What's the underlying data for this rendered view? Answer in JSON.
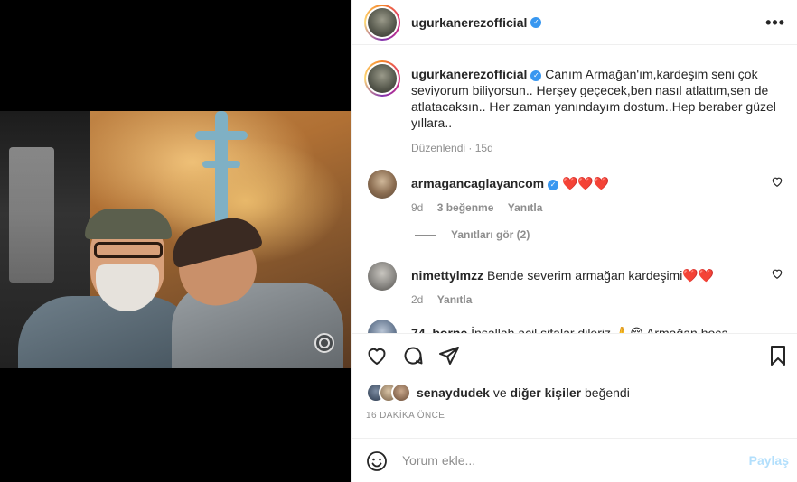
{
  "post": {
    "username": "ugurkanerezofficial",
    "verified_icon": "verified-badge-icon",
    "caption": "Canım Armağan'ım,kardeşim seni çok seviyorum biliyorsun.. Herşey geçecek,ben nasıl atlattım,sen de atlatacaksın.. Her zaman yanındayım dostum..Hep beraber güzel yıllara..",
    "edited_label": "Düzenlendi",
    "caption_age": "15d"
  },
  "comments": [
    {
      "username": "armagancaglayancom",
      "verified": true,
      "text": "❤️❤️❤️",
      "age": "9d",
      "likes": "3 beğenme",
      "reply_label": "Yanıtla",
      "view_replies": "Yanıtları gör (2)"
    },
    {
      "username": "nimettylmzz",
      "verified": false,
      "text": "Bende severim armağan kardeşimi❤️❤️",
      "age": "2d",
      "reply_label": "Yanıtla"
    },
    {
      "username": "74_borne",
      "text": "İnşallah acil şifalar dileriz 🙏😔 Armağan hoca"
    }
  ],
  "liked_by": {
    "user": "senaydudek",
    "connector": "ve",
    "others": "diğer kişiler",
    "suffix": "beğendi"
  },
  "timestamp": "16 DAKİKA ÖNCE",
  "add_comment": {
    "placeholder": "Yorum ekle...",
    "post_label": "Paylaş"
  },
  "colors": {
    "accent": "#0095f6",
    "heart_red": "#ed4956",
    "muted": "#8e8e8e",
    "post_disabled": "#b2dffc"
  }
}
